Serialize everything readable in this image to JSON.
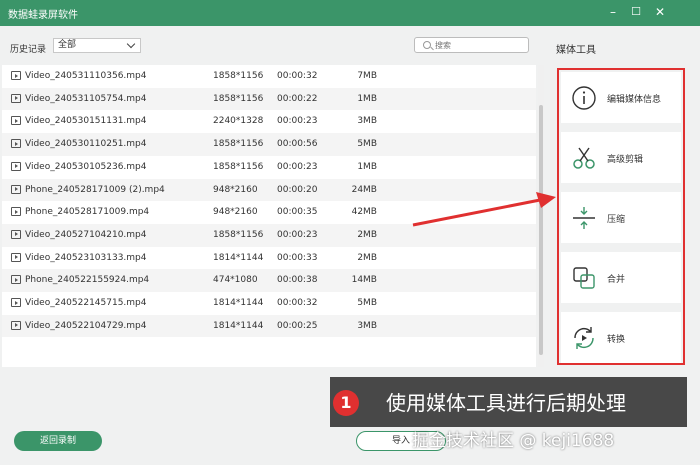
{
  "window": {
    "title": "数据蛙录屏软件",
    "minimize": "–",
    "maximize": "☐",
    "close": "✕"
  },
  "filter": {
    "label": "历史记录",
    "selected": "全部",
    "search_placeholder": "搜索"
  },
  "files": [
    {
      "name": "Video_240531110356.mp4",
      "resolution": "1858*1156",
      "duration": "00:00:32",
      "size": "7MB"
    },
    {
      "name": "Video_240531105754.mp4",
      "resolution": "1858*1156",
      "duration": "00:00:22",
      "size": "1MB"
    },
    {
      "name": "Video_240530151131.mp4",
      "resolution": "2240*1328",
      "duration": "00:00:23",
      "size": "3MB"
    },
    {
      "name": "Video_240530110251.mp4",
      "resolution": "1858*1156",
      "duration": "00:00:56",
      "size": "5MB"
    },
    {
      "name": "Video_240530105236.mp4",
      "resolution": "1858*1156",
      "duration": "00:00:23",
      "size": "1MB"
    },
    {
      "name": "Phone_240528171009 (2).mp4",
      "resolution": "948*2160",
      "duration": "00:00:20",
      "size": "24MB"
    },
    {
      "name": "Phone_240528171009.mp4",
      "resolution": "948*2160",
      "duration": "00:00:35",
      "size": "42MB"
    },
    {
      "name": "Video_240527104210.mp4",
      "resolution": "1858*1156",
      "duration": "00:00:23",
      "size": "2MB"
    },
    {
      "name": "Video_240523103133.mp4",
      "resolution": "1814*1144",
      "duration": "00:00:33",
      "size": "2MB"
    },
    {
      "name": "Phone_240522155924.mp4",
      "resolution": "474*1080",
      "duration": "00:00:38",
      "size": "14MB"
    },
    {
      "name": "Video_240522145715.mp4",
      "resolution": "1814*1144",
      "duration": "00:00:32",
      "size": "5MB"
    },
    {
      "name": "Video_240522104729.mp4",
      "resolution": "1814*1144",
      "duration": "00:00:25",
      "size": "3MB"
    }
  ],
  "buttons": {
    "back": "返回录制",
    "import": "导入"
  },
  "media_tools": {
    "title": "媒体工具",
    "items": [
      {
        "label": "编辑媒体信息",
        "icon": "info-icon"
      },
      {
        "label": "高级剪辑",
        "icon": "scissors-icon"
      },
      {
        "label": "压缩",
        "icon": "compress-icon"
      },
      {
        "label": "合并",
        "icon": "merge-icon"
      },
      {
        "label": "转换",
        "icon": "convert-icon"
      }
    ]
  },
  "annotation": {
    "number": "1",
    "text": "使用媒体工具进行后期处理",
    "watermark": "掘金技术社区 @ keji1688"
  },
  "colors": {
    "brand": "#3b9569",
    "highlight": "#e03030"
  }
}
